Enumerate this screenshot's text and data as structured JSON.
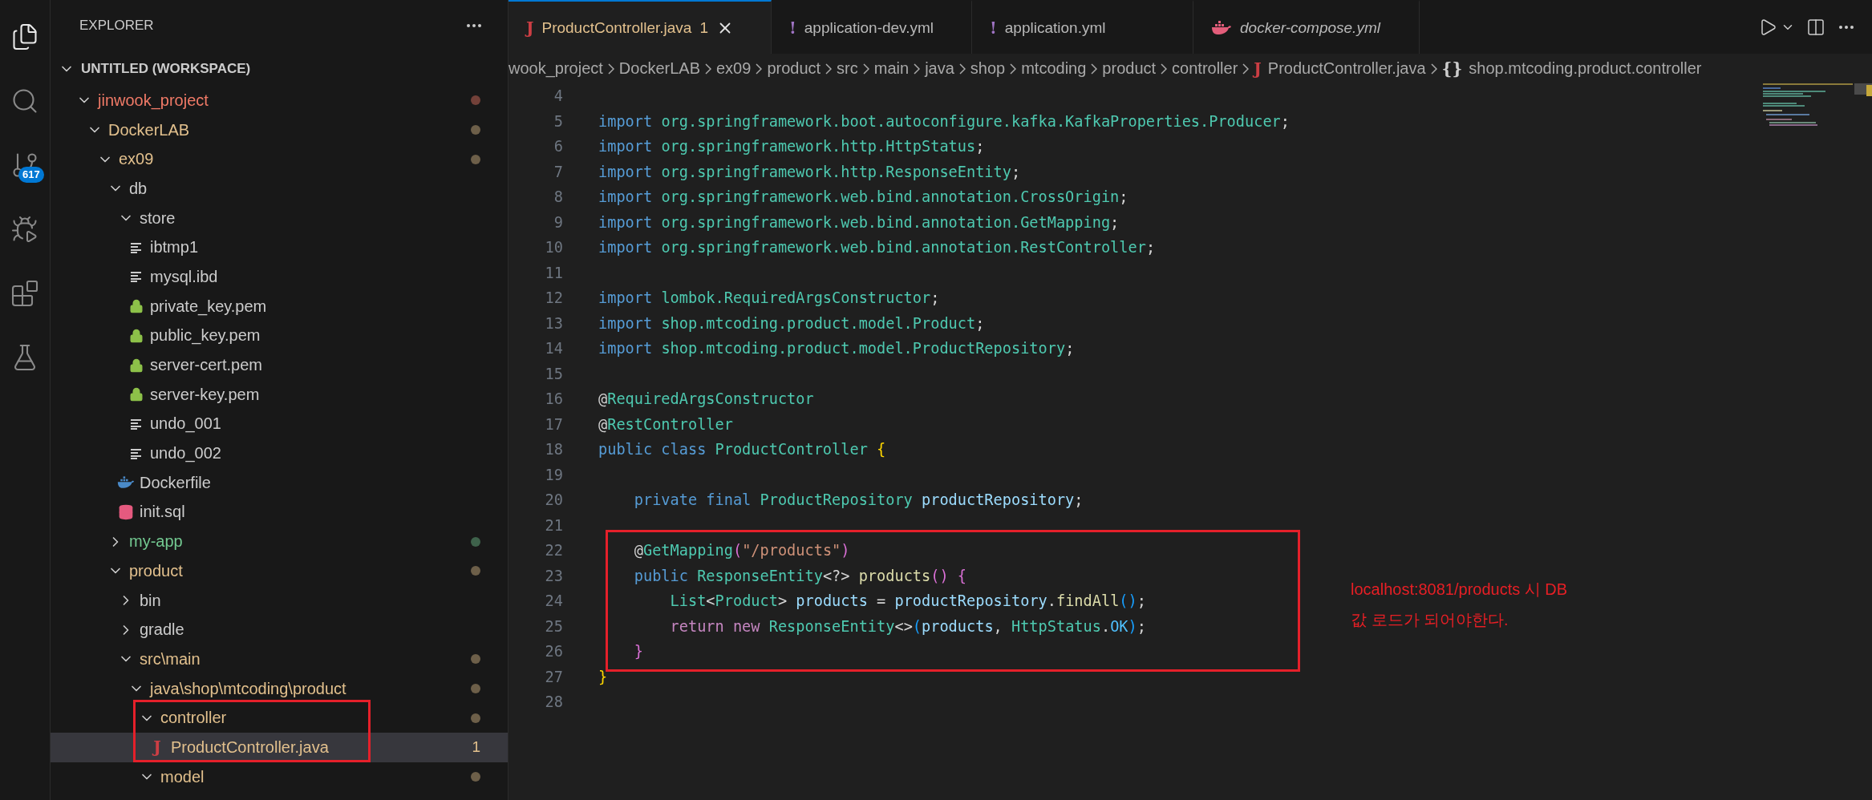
{
  "activity_bar": [
    {
      "kind": "explorer",
      "selected": true
    },
    {
      "kind": "search",
      "selected": false
    },
    {
      "kind": "source-control",
      "selected": false,
      "badge": "617"
    },
    {
      "kind": "run-debug",
      "selected": false
    },
    {
      "kind": "extensions",
      "selected": false
    },
    {
      "kind": "testing",
      "selected": false
    }
  ],
  "explorer": {
    "title": "EXPLORER",
    "workspace": {
      "label": "UNTITLED (WORKSPACE)",
      "expanded": true,
      "children": [
        {
          "label": "jinwook_project",
          "kind": "folder",
          "expanded": true,
          "color": "#f07a67",
          "selected": false,
          "highlighted": false,
          "children": [
            {
              "label": "DockerLAB",
              "kind": "folder",
              "expanded": true,
              "color": "#e2c08d",
              "selected": false,
              "highlighted": false,
              "children": [
                {
                  "label": "ex09",
                  "kind": "folder",
                  "expanded": true,
                  "color": "#e2c08d",
                  "selected": false,
                  "highlighted": false,
                  "children": [
                    {
                      "label": "db",
                      "kind": "folder",
                      "expanded": true,
                      "selected": false,
                      "highlighted": false,
                      "children": [
                        {
                          "label": "store",
                          "kind": "folder",
                          "expanded": true,
                          "selected": false,
                          "highlighted": false,
                          "children": [
                            {
                              "label": "ibtmp1",
                              "kind": "text-file",
                              "selected": false,
                              "highlighted": false
                            },
                            {
                              "label": "mysql.ibd",
                              "kind": "text-file",
                              "selected": false,
                              "highlighted": false
                            },
                            {
                              "label": "private_key.pem",
                              "kind": "key-file",
                              "selected": false,
                              "highlighted": false
                            },
                            {
                              "label": "public_key.pem",
                              "kind": "key-file",
                              "selected": false,
                              "highlighted": false
                            },
                            {
                              "label": "server-cert.pem",
                              "kind": "key-file",
                              "selected": false,
                              "highlighted": false
                            },
                            {
                              "label": "server-key.pem",
                              "kind": "key-file",
                              "selected": false,
                              "highlighted": false
                            },
                            {
                              "label": "undo_001",
                              "kind": "text-file",
                              "selected": false,
                              "highlighted": false
                            },
                            {
                              "label": "undo_002",
                              "kind": "text-file",
                              "selected": false,
                              "highlighted": false
                            }
                          ]
                        },
                        {
                          "label": "Dockerfile",
                          "kind": "docker-file",
                          "selected": false,
                          "highlighted": false
                        },
                        {
                          "label": "init.sql",
                          "kind": "sql-file",
                          "selected": false,
                          "highlighted": false
                        }
                      ]
                    },
                    {
                      "label": "my-app",
                      "kind": "folder",
                      "expanded": false,
                      "color": "#73c991",
                      "selected": false,
                      "highlighted": false
                    },
                    {
                      "label": "product",
                      "kind": "folder",
                      "expanded": true,
                      "color": "#e2c08d",
                      "selected": false,
                      "highlighted": false,
                      "children": [
                        {
                          "label": "bin",
                          "kind": "folder",
                          "expanded": false,
                          "selected": false,
                          "highlighted": false
                        },
                        {
                          "label": "gradle",
                          "kind": "folder",
                          "expanded": false,
                          "selected": false,
                          "highlighted": false
                        },
                        {
                          "label": "src\\main",
                          "kind": "folder",
                          "expanded": true,
                          "color": "#e2c08d",
                          "selected": false,
                          "highlighted": false,
                          "children": [
                            {
                              "label": "java\\shop\\mtcoding\\product",
                              "kind": "folder",
                              "expanded": true,
                              "color": "#e2c08d",
                              "selected": false,
                              "highlighted": false,
                              "children": [
                                {
                                  "label": "controller",
                                  "kind": "folder",
                                  "expanded": true,
                                  "color": "#e2c08d",
                                  "selected": false,
                                  "highlighted": true,
                                  "children": [
                                    {
                                      "label": "ProductController.java",
                                      "kind": "java-file",
                                      "glyph": "J",
                                      "color": "#e2c08d",
                                      "badge": "1",
                                      "selected": true,
                                      "highlighted": true
                                    }
                                  ]
                                },
                                {
                                  "label": "model",
                                  "kind": "folder",
                                  "expanded": true,
                                  "color": "#e2c08d",
                                  "selected": false,
                                  "highlighted": false
                                }
                              ]
                            }
                          ]
                        }
                      ]
                    }
                  ]
                }
              ]
            }
          ]
        }
      ]
    }
  },
  "tabs": [
    {
      "label": "ProductController.java",
      "kind": "java-file",
      "glyph": "J",
      "color": "#e2c08d",
      "problems": "1",
      "selected": true,
      "preview": false
    },
    {
      "label": "application-dev.yml",
      "kind": "yaml-file",
      "glyph": "!",
      "selected": false,
      "preview": false
    },
    {
      "label": "application.yml",
      "kind": "yaml-file",
      "glyph": "!",
      "selected": false,
      "preview": false
    },
    {
      "label": "docker-compose.yml",
      "kind": "compose-file",
      "selected": false,
      "preview": true
    }
  ],
  "breadcrumbs": [
    {
      "label": "wook_project",
      "kind": "folder"
    },
    {
      "label": "DockerLAB",
      "kind": "folder"
    },
    {
      "label": "ex09",
      "kind": "folder"
    },
    {
      "label": "product",
      "kind": "folder"
    },
    {
      "label": "src",
      "kind": "folder"
    },
    {
      "label": "main",
      "kind": "folder"
    },
    {
      "label": "java",
      "kind": "folder"
    },
    {
      "label": "shop",
      "kind": "folder"
    },
    {
      "label": "mtcoding",
      "kind": "folder"
    },
    {
      "label": "product",
      "kind": "folder"
    },
    {
      "label": "controller",
      "kind": "folder"
    },
    {
      "label": "ProductController.java",
      "kind": "java-file",
      "glyph": "J"
    },
    {
      "label": "shop.mtcoding.product.controller",
      "kind": "namespace",
      "glyph": "{}"
    }
  ],
  "code": {
    "lines": [
      {
        "number": "4",
        "highlighted": false
      },
      {
        "number": "5",
        "highlighted": false,
        "tokens": [
          {
            "text": "import ",
            "kind": "kw"
          },
          {
            "text": "org.springframework.boot.autoconfigure.kafka.KafkaProperties.Producer",
            "kind": "type"
          },
          {
            "text": ";",
            "kind": "plain"
          }
        ]
      },
      {
        "number": "6",
        "highlighted": false,
        "tokens": [
          {
            "text": "import ",
            "kind": "kw"
          },
          {
            "text": "org.springframework.http.HttpStatus",
            "kind": "type"
          },
          {
            "text": ";",
            "kind": "plain"
          }
        ]
      },
      {
        "number": "7",
        "highlighted": false,
        "tokens": [
          {
            "text": "import ",
            "kind": "kw"
          },
          {
            "text": "org.springframework.http.ResponseEntity",
            "kind": "type"
          },
          {
            "text": ";",
            "kind": "plain"
          }
        ]
      },
      {
        "number": "8",
        "highlighted": false,
        "tokens": [
          {
            "text": "import ",
            "kind": "kw"
          },
          {
            "text": "org.springframework.web.bind.annotation.CrossOrigin",
            "kind": "type"
          },
          {
            "text": ";",
            "kind": "plain"
          }
        ]
      },
      {
        "number": "9",
        "highlighted": false,
        "tokens": [
          {
            "text": "import ",
            "kind": "kw"
          },
          {
            "text": "org.springframework.web.bind.annotation.GetMapping",
            "kind": "type"
          },
          {
            "text": ";",
            "kind": "plain"
          }
        ]
      },
      {
        "number": "10",
        "highlighted": false,
        "tokens": [
          {
            "text": "import ",
            "kind": "kw"
          },
          {
            "text": "org.springframework.web.bind.annotation.RestController",
            "kind": "type"
          },
          {
            "text": ";",
            "kind": "plain"
          }
        ]
      },
      {
        "number": "11",
        "highlighted": false
      },
      {
        "number": "12",
        "highlighted": false,
        "tokens": [
          {
            "text": "import ",
            "kind": "kw"
          },
          {
            "text": "lombok.RequiredArgsConstructor",
            "kind": "type"
          },
          {
            "text": ";",
            "kind": "plain"
          }
        ]
      },
      {
        "number": "13",
        "highlighted": false,
        "tokens": [
          {
            "text": "import ",
            "kind": "kw"
          },
          {
            "text": "shop.mtcoding.product.model.Product",
            "kind": "type"
          },
          {
            "text": ";",
            "kind": "plain"
          }
        ]
      },
      {
        "number": "14",
        "highlighted": false,
        "tokens": [
          {
            "text": "import ",
            "kind": "kw"
          },
          {
            "text": "shop.mtcoding.product.model.ProductRepository",
            "kind": "type"
          },
          {
            "text": ";",
            "kind": "plain"
          }
        ]
      },
      {
        "number": "15",
        "highlighted": false
      },
      {
        "number": "16",
        "highlighted": false,
        "tokens": [
          {
            "text": "@",
            "kind": "plain"
          },
          {
            "text": "RequiredArgsConstructor",
            "kind": "type"
          }
        ]
      },
      {
        "number": "17",
        "highlighted": false,
        "tokens": [
          {
            "text": "@",
            "kind": "plain"
          },
          {
            "text": "RestController",
            "kind": "type"
          }
        ]
      },
      {
        "number": "18",
        "highlighted": false,
        "tokens": [
          {
            "text": "public class ",
            "kind": "kw"
          },
          {
            "text": "ProductController ",
            "kind": "type"
          },
          {
            "text": "{",
            "kind": "brace1"
          }
        ]
      },
      {
        "number": "19",
        "highlighted": false
      },
      {
        "number": "20",
        "highlighted": false,
        "tokens": [
          {
            "text": "    private final ",
            "kind": "kw"
          },
          {
            "text": "ProductRepository ",
            "kind": "type"
          },
          {
            "text": "productRepository",
            "kind": "var"
          },
          {
            "text": ";",
            "kind": "plain"
          }
        ]
      },
      {
        "number": "21",
        "highlighted": false
      },
      {
        "number": "22",
        "highlighted": true,
        "tokens": [
          {
            "text": "    @",
            "kind": "plain"
          },
          {
            "text": "GetMapping",
            "kind": "type"
          },
          {
            "text": "(",
            "kind": "brace2"
          },
          {
            "text": "\"/products\"",
            "kind": "str"
          },
          {
            "text": ")",
            "kind": "brace2"
          }
        ]
      },
      {
        "number": "23",
        "highlighted": true,
        "tokens": [
          {
            "text": "    public ",
            "kind": "kw"
          },
          {
            "text": "ResponseEntity",
            "kind": "type"
          },
          {
            "text": "<?> ",
            "kind": "plain"
          },
          {
            "text": "products",
            "kind": "fn"
          },
          {
            "text": "() ",
            "kind": "brace2"
          },
          {
            "text": "{",
            "kind": "brace2"
          }
        ]
      },
      {
        "number": "24",
        "highlighted": true,
        "tokens": [
          {
            "text": "        List",
            "kind": "type"
          },
          {
            "text": "<",
            "kind": "plain"
          },
          {
            "text": "Product",
            "kind": "type"
          },
          {
            "text": "> ",
            "kind": "plain"
          },
          {
            "text": "products",
            "kind": "var"
          },
          {
            "text": " = ",
            "kind": "plain"
          },
          {
            "text": "productRepository",
            "kind": "var"
          },
          {
            "text": ".",
            "kind": "plain"
          },
          {
            "text": "findAll",
            "kind": "fn"
          },
          {
            "text": "()",
            "kind": "brace3"
          },
          {
            "text": ";",
            "kind": "plain"
          }
        ]
      },
      {
        "number": "25",
        "highlighted": true,
        "tokens": [
          {
            "text": "        return new ",
            "kind": "control"
          },
          {
            "text": "ResponseEntity",
            "kind": "type"
          },
          {
            "text": "<>",
            "kind": "plain"
          },
          {
            "text": "(",
            "kind": "brace3"
          },
          {
            "text": "products",
            "kind": "var"
          },
          {
            "text": ", ",
            "kind": "plain"
          },
          {
            "text": "HttpStatus",
            "kind": "type"
          },
          {
            "text": ".",
            "kind": "plain"
          },
          {
            "text": "OK",
            "kind": "const"
          },
          {
            "text": ")",
            "kind": "brace3"
          },
          {
            "text": ";",
            "kind": "plain"
          }
        ]
      },
      {
        "number": "26",
        "highlighted": true,
        "tokens": [
          {
            "text": "    }",
            "kind": "brace2"
          }
        ]
      },
      {
        "number": "27",
        "highlighted": false,
        "tokens": [
          {
            "text": "}",
            "kind": "brace1"
          }
        ]
      },
      {
        "number": "28",
        "highlighted": false
      }
    ]
  },
  "note": {
    "lines": [
      "localhost:8081/products 시 DB",
      "값 로드가 되어야한다."
    ]
  }
}
